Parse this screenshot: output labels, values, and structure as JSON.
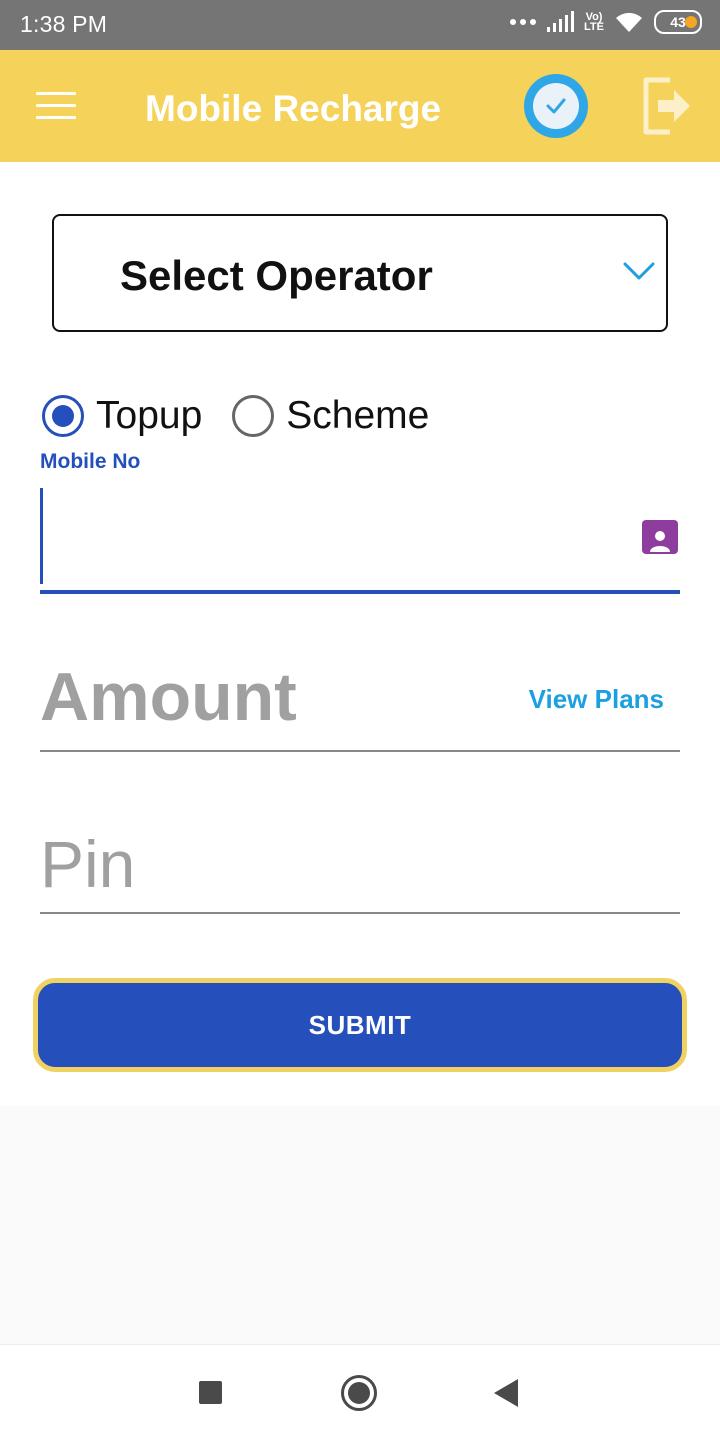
{
  "status_bar": {
    "time": "1:38 PM",
    "network_type": "LTE",
    "battery_level": "43",
    "icons": [
      "more-dots-icon",
      "signal-bars-icon",
      "volte-icon",
      "wifi-icon",
      "battery-icon"
    ]
  },
  "app_bar": {
    "title": "Mobile Recharge",
    "menu_icon": "hamburger-menu-icon",
    "check_icon": "check-circle-icon",
    "logout_icon": "logout-icon"
  },
  "form": {
    "operator_placeholder": "Select Operator",
    "recharge_types": [
      {
        "label": "Topup",
        "selected": true
      },
      {
        "label": "Scheme",
        "selected": false
      }
    ],
    "mobile_label": "Mobile No",
    "mobile_value": "",
    "amount_placeholder": "Amount",
    "view_plans_label": "View Plans",
    "pin_placeholder": "Pin",
    "submit_label": "SUBMIT"
  },
  "colors": {
    "app_bar": "#f5d25a",
    "primary": "#254fba",
    "link": "#1da0e0",
    "contact_icon": "#8e3c9e"
  },
  "nav_bar": {
    "icons": [
      "recents-square-icon",
      "home-circle-icon",
      "back-triangle-icon"
    ]
  }
}
